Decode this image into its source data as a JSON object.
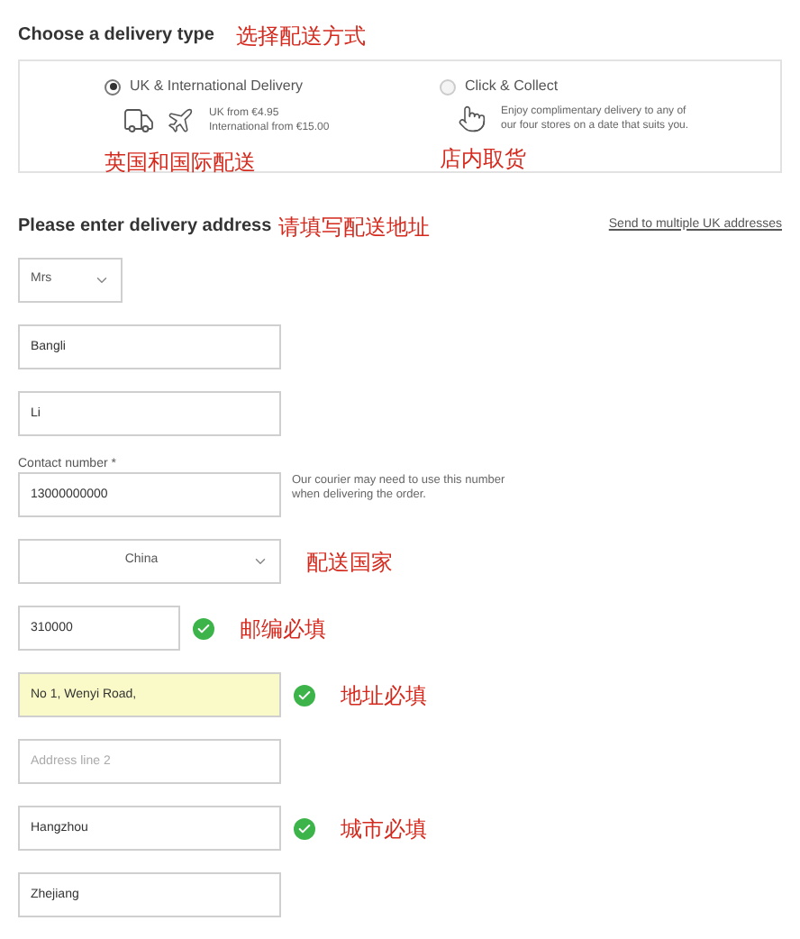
{
  "delivery_type": {
    "title": "Choose a delivery type",
    "annotation": "选择配送方式",
    "options": [
      {
        "label": "UK & International Delivery",
        "selected": true,
        "kind": "shipping",
        "details": [
          "UK from €4.95",
          "International from €15.00"
        ],
        "annotation": "英国和国际配送"
      },
      {
        "label": "Click & Collect",
        "selected": false,
        "kind": "collect",
        "details": [
          "Enjoy complimentary delivery to any of",
          "our four stores on a date that suits you."
        ],
        "annotation": "店内取货"
      }
    ]
  },
  "address": {
    "title": "Please enter delivery address",
    "annotation": "请填写配送地址",
    "link": "Send to multiple UK addresses",
    "fields": [
      {
        "kind": "salutation",
        "value": "Mrs",
        "valid": false,
        "highlighted": false
      },
      {
        "kind": "input",
        "value": "Bangli",
        "valid": false,
        "highlighted": false
      },
      {
        "kind": "input",
        "value": "Li",
        "valid": false,
        "highlighted": false
      },
      {
        "kind": "input",
        "label": "Contact number *",
        "value": "13000000000",
        "hint": "Our courier may need to use this number when delivering the order.",
        "valid": false,
        "highlighted": false
      },
      {
        "kind": "select",
        "value": "China",
        "annotation": "配送国家",
        "valid": false,
        "highlighted": false
      },
      {
        "kind": "postcode",
        "value": "310000",
        "annotation": "邮编必填",
        "valid": true,
        "highlighted": false
      },
      {
        "kind": "input",
        "value": "No 1, Wenyi Road,",
        "annotation": "地址必填",
        "valid": true,
        "highlighted": true
      },
      {
        "kind": "input",
        "placeholder": "Address line 2",
        "valid": false,
        "highlighted": false
      },
      {
        "kind": "input",
        "value": "Hangzhou",
        "annotation": "城市必填",
        "valid": true,
        "highlighted": false
      },
      {
        "kind": "input",
        "value": "Zhejiang",
        "valid": false,
        "highlighted": false
      }
    ]
  }
}
